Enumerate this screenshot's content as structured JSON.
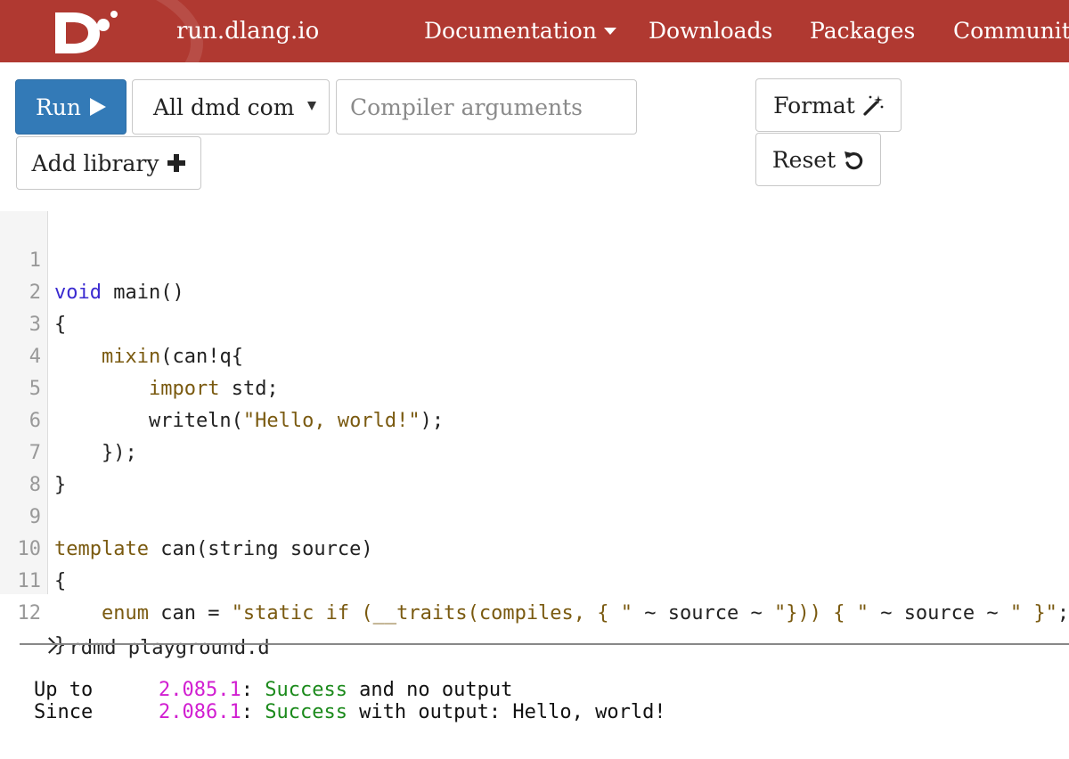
{
  "navbar": {
    "brand": "run.dlang.io",
    "logo_icon": "d-logo-icon",
    "items": [
      {
        "label": "Documentation",
        "dropdown": true
      },
      {
        "label": "Downloads"
      },
      {
        "label": "Packages"
      },
      {
        "label": "Community"
      }
    ],
    "background_color": "#b03931"
  },
  "toolbar": {
    "run_label": "Run",
    "compiler_selected": "All dmd com",
    "args_placeholder": "Compiler arguments",
    "add_library_label": "Add library",
    "format_label": "Format",
    "reset_label": "Reset",
    "run_color": "#337ab7"
  },
  "editor": {
    "lines": [
      {
        "n": "1",
        "text": "void main()"
      },
      {
        "n": "2",
        "text": "{"
      },
      {
        "n": "3",
        "text": "    mixin(can!q{"
      },
      {
        "n": "4",
        "text": "        import std;"
      },
      {
        "n": "5",
        "text": "        writeln(\"Hello, world!\");"
      },
      {
        "n": "6",
        "text": "    });"
      },
      {
        "n": "7",
        "text": "}"
      },
      {
        "n": "8",
        "text": ""
      },
      {
        "n": "9",
        "text": "template can(string source)"
      },
      {
        "n": "10",
        "text": "{"
      },
      {
        "n": "11",
        "text": "    enum can = \"static if (__traits(compiles, { \" ~ source ~ \"})) { \" ~ source ~ \" }\";"
      },
      {
        "n": "12",
        "text": "}"
      }
    ]
  },
  "terminal": {
    "command": "rdmd playground.d",
    "results": [
      {
        "label": "Up to",
        "version": "2.085.1",
        "sep": ":",
        "status": "Success",
        "rest": " and no output"
      },
      {
        "label": "Since",
        "version": "2.086.1",
        "sep": ":",
        "status": "Success",
        "rest": " with output: Hello, world!"
      }
    ]
  }
}
